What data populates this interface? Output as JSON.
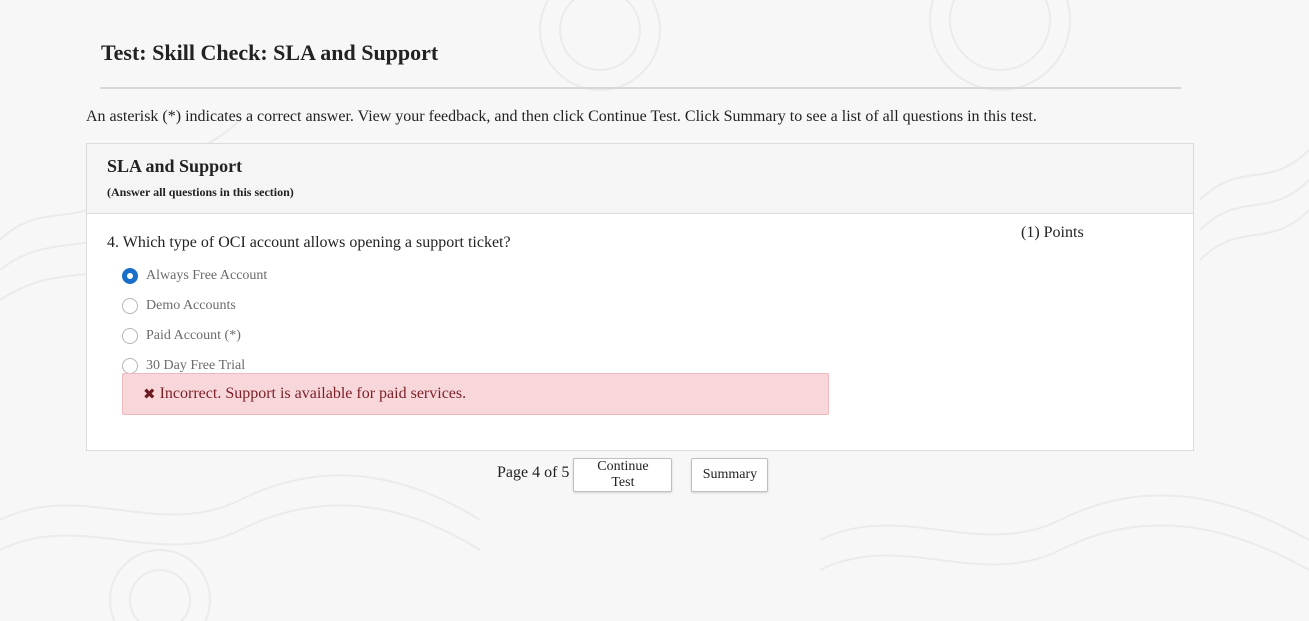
{
  "page": {
    "title": "Test: Skill Check: SLA and Support",
    "instructions": "An asterisk (*) indicates a correct answer. View your feedback, and then click Continue Test. Click Summary to see a list of all questions in this test."
  },
  "section": {
    "title": "SLA and Support",
    "subtitle": "(Answer all questions in this section)"
  },
  "question": {
    "text": "4. Which type of OCI account allows opening a support ticket?",
    "points": "(1) Points",
    "options": [
      {
        "label": "Always Free Account",
        "selected": true
      },
      {
        "label": "Demo Accounts",
        "selected": false
      },
      {
        "label": "Paid Account (*)",
        "selected": false
      },
      {
        "label": "30 Day Free Trial",
        "selected": false
      }
    ],
    "feedback": {
      "icon": "x-icon",
      "text": "Incorrect. Support is available for paid services."
    }
  },
  "navigation": {
    "page_indicator": "Page 4 of 5",
    "continue_label": "Continue Test",
    "summary_label": "Summary"
  },
  "colors": {
    "accent": "#1a6fc9",
    "error_bg": "#f8d7da",
    "error_text": "#7a1f26"
  }
}
